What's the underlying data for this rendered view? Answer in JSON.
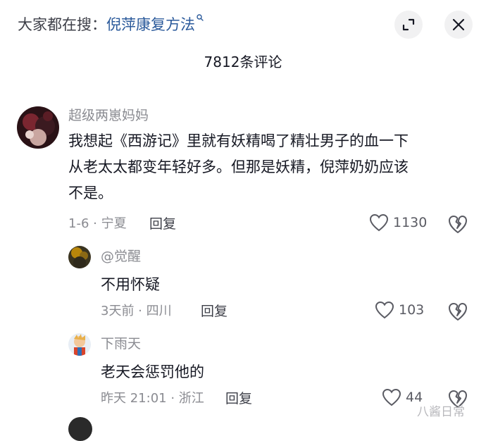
{
  "header": {
    "search_prefix": "大家都在搜：",
    "search_term": "倪萍康复方法",
    "expand_icon": "expand-corner-icon",
    "close_icon": "close-icon"
  },
  "comment_count_label": "7812条评论",
  "comments": [
    {
      "username": "超级两崽妈妈",
      "lines": [
        "我想起《西游记》里就有妖精喝了精壮男子的血一下",
        "从老太太都变年轻好多。但那是妖精，倪萍奶奶应该",
        "不是。"
      ],
      "meta": "1-6 · 宁夏",
      "reply_label": "回复",
      "likes": "1130"
    },
    {
      "username": "@觉醒",
      "lines": [
        "不用怀疑"
      ],
      "meta": "3天前 · 四川",
      "reply_label": "回复",
      "likes": "103"
    },
    {
      "username": "下雨天",
      "lines": [
        "老天会惩罚他的"
      ],
      "meta": "昨天 21:01 · 浙江",
      "reply_label": "回复",
      "likes": "44"
    }
  ],
  "watermark": "八酱日常",
  "colors": {
    "text_primary": "#161823",
    "text_secondary": "#8a8b91",
    "search_term": "#2b5a9b",
    "button_bg": "#f1f1f2"
  }
}
